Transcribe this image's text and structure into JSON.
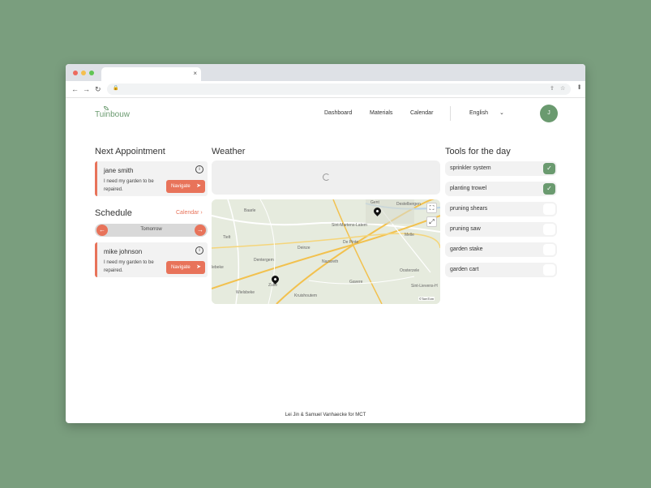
{
  "browser": {
    "tab_close": "×",
    "back": "←",
    "forward": "→",
    "reload": "↻"
  },
  "header": {
    "brand": "Tuinbouw",
    "nav": {
      "dashboard": "Dashboard",
      "materials": "Materials",
      "calendar": "Calendar"
    },
    "language": "English",
    "avatar_initial": "J"
  },
  "next_appointment": {
    "title": "Next Appointment",
    "name": "jane smith",
    "description": "I need my garden to be repaired.",
    "navigate_label": "Navigate"
  },
  "schedule": {
    "title": "Schedule",
    "calendar_link": "Calendar",
    "day_label": "Tomorrow",
    "appointment": {
      "name": "mike johnson",
      "description": "I need my garden to be repaired.",
      "navigate_label": "Navigate"
    }
  },
  "weather": {
    "title": "Weather"
  },
  "map": {
    "labels": [
      "Gent",
      "Destelbergen",
      "Baarle",
      "Sint-Martens-Latem",
      "Tielt",
      "Deinze",
      "De Pinte",
      "Melle",
      "Dentergem",
      "Nazareth",
      "Oosterzele",
      "Gavere",
      "Zulte",
      "Sint-Lievens-H",
      "Wielsbeke",
      "Kruishoutem",
      "lebeke"
    ],
    "attribution": "©TomTom"
  },
  "tools": {
    "title": "Tools for the day",
    "items": [
      {
        "label": "sprinkler system",
        "checked": true
      },
      {
        "label": "planting trowel",
        "checked": true
      },
      {
        "label": "pruning shears",
        "checked": false
      },
      {
        "label": "pruning saw",
        "checked": false
      },
      {
        "label": "garden stake",
        "checked": false
      },
      {
        "label": "garden cart",
        "checked": false
      }
    ]
  },
  "footer": {
    "text": "Lei Jin & Samuel Vanhaecke for MCT"
  },
  "colors": {
    "accent": "#e8735a",
    "brand": "#6a9a6f",
    "background": "#7a9e7e"
  }
}
